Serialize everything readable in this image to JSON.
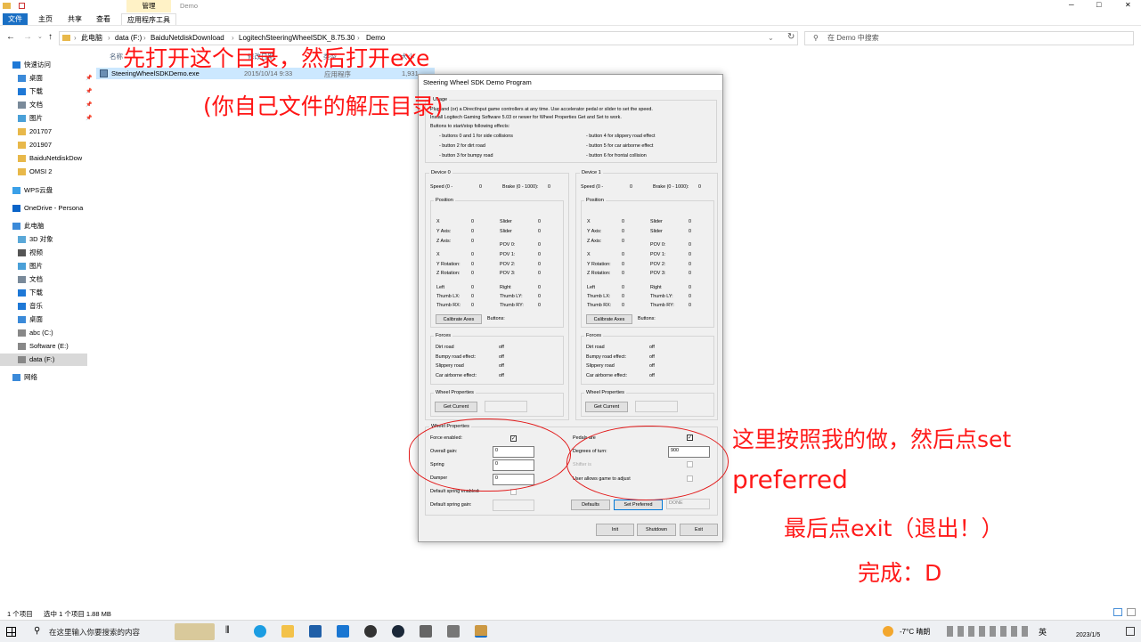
{
  "window": {
    "title": "Demo",
    "ribbon_context_tab": "管理",
    "controls": {
      "minimize": "─",
      "maximize": "□",
      "close": "✕"
    }
  },
  "ribbon": {
    "tabs": [
      "文件",
      "主页",
      "共享",
      "查看"
    ],
    "context_tool": "应用程序工具"
  },
  "address": {
    "crumbs": [
      "此电脑",
      "data (F:)",
      "BaiduNetdiskDownload",
      "LogitechSteeringWheelSDK_8.75.30",
      "Demo"
    ],
    "search_placeholder": "在 Demo 中搜索"
  },
  "nav": {
    "items": [
      {
        "label": "快速访问",
        "icon": "star-icon",
        "pinned": false
      },
      {
        "label": "桌面",
        "icon": "desktop-icon",
        "pinned": true
      },
      {
        "label": "下载",
        "icon": "download-icon",
        "pinned": true
      },
      {
        "label": "文档",
        "icon": "document-icon",
        "pinned": true
      },
      {
        "label": "图片",
        "icon": "pictures-icon",
        "pinned": true
      },
      {
        "label": "201707",
        "icon": "folder-icon",
        "pinned": false
      },
      {
        "label": "201907",
        "icon": "folder-icon",
        "pinned": false
      },
      {
        "label": "BaiduNetdiskDow",
        "icon": "folder-icon",
        "pinned": false
      },
      {
        "label": "OMSI 2",
        "icon": "folder-icon",
        "pinned": false
      },
      {
        "label": "WPS云盘",
        "icon": "cloud-icon",
        "pinned": false
      },
      {
        "label": "OneDrive - Persona",
        "icon": "onedrive-icon",
        "pinned": false
      },
      {
        "label": "此电脑",
        "icon": "computer-icon",
        "pinned": false
      },
      {
        "label": "3D 对象",
        "icon": "3d-objects-icon",
        "pinned": false
      },
      {
        "label": "视频",
        "icon": "video-icon",
        "pinned": false
      },
      {
        "label": "图片",
        "icon": "pictures-icon",
        "pinned": false
      },
      {
        "label": "文档",
        "icon": "document-icon",
        "pinned": false
      },
      {
        "label": "下载",
        "icon": "download-icon",
        "pinned": false
      },
      {
        "label": "音乐",
        "icon": "music-icon",
        "pinned": false
      },
      {
        "label": "桌面",
        "icon": "desktop-icon",
        "pinned": false
      },
      {
        "label": "abc (C:)",
        "icon": "drive-icon",
        "pinned": false
      },
      {
        "label": "Software (E:)",
        "icon": "drive-icon",
        "pinned": false
      },
      {
        "label": "data (F:)",
        "icon": "drive-icon",
        "pinned": false
      },
      {
        "label": "网络",
        "icon": "network-icon",
        "pinned": false
      }
    ]
  },
  "filelist": {
    "headers": [
      "名称",
      "修改日期",
      "类型",
      "大小"
    ],
    "rows": [
      {
        "name": "SteeringWheelSDKDemo.exe",
        "date": "2015/10/14 9:33",
        "type": "应用程序",
        "size": "1,931"
      }
    ]
  },
  "statusbar": {
    "count": "1 个项目",
    "selected": "选中 1 个项目  1.88 MB"
  },
  "dialog": {
    "title": "Steering Wheel SDK Demo Program",
    "usage_label": "Usage",
    "usage_line1": "Plug and (or) a DirectInput game controllers at any time. Use accelerator pedal or slider to set the speed.",
    "usage_line2": "Install Logitech Gaming Software 5.03 or newer for Wheel Properties Get and Set to work.",
    "usage_line3": "Buttons to start/stop following effects:",
    "effects_left": [
      "- buttons 0 and 1 for side collisions",
      "- button 2 for dirt road",
      "- button 3 for bumpy road"
    ],
    "effects_right": [
      "- button 4 for slippery road effect",
      "- button 5 for car airborne effect",
      "- button 6 for frontal collision"
    ],
    "devices": [
      {
        "label": "Device 0",
        "speed_label": "Speed (0 -",
        "speed_val": "0",
        "brake_label": "Brake (0 - 1000):",
        "brake_val": "0",
        "position_label": "Position",
        "axes_left": [
          [
            "X",
            "0"
          ],
          [
            "Y Axis:",
            "0"
          ],
          [
            "Z Axis:",
            "0"
          ]
        ],
        "axes_right": [
          [
            "Slider",
            "0"
          ],
          [
            "Slider",
            "0"
          ]
        ],
        "pov": [
          [
            "POV 0:",
            "0"
          ],
          [
            "POV 1:",
            "0"
          ],
          [
            "POV 2:",
            "0"
          ],
          [
            "POV 3:",
            "0"
          ]
        ],
        "rot": [
          [
            "X",
            "0"
          ],
          [
            "Y Rotation:",
            "0"
          ],
          [
            "Z Rotation:",
            "0"
          ]
        ],
        "thumb_left": [
          [
            "Left",
            "0"
          ],
          [
            "Thumb LX:",
            "0"
          ],
          [
            "Thumb RX:",
            "0"
          ]
        ],
        "thumb_right": [
          [
            "Right",
            "0"
          ],
          [
            "Thumb LY:",
            "0"
          ],
          [
            "Thumb RY:",
            "0"
          ]
        ],
        "calibrate": "Calibrate Axes",
        "buttons_label": "Buttons:",
        "forces_label": "Forces",
        "forces": [
          [
            "Dirt road",
            "off"
          ],
          [
            "Bumpy road effect:",
            "off"
          ],
          [
            "Slippery road",
            "off"
          ],
          [
            "Car airborne effect:",
            "off"
          ]
        ],
        "wheel_props": "Wheel Properties",
        "get_current": "Get Current"
      },
      {
        "label": "Device 1",
        "speed_label": "Speed (0 -",
        "speed_val": "0",
        "brake_label": "Brake (0 - 1000):",
        "brake_val": "0",
        "position_label": "Position",
        "axes_left": [
          [
            "X",
            "0"
          ],
          [
            "Y Axis:",
            "0"
          ],
          [
            "Z Axis:",
            "0"
          ]
        ],
        "axes_right": [
          [
            "Slider",
            "0"
          ],
          [
            "Slider",
            "0"
          ]
        ],
        "pov": [
          [
            "POV 0:",
            "0"
          ],
          [
            "POV 1:",
            "0"
          ],
          [
            "POV 2:",
            "0"
          ],
          [
            "POV 3:",
            "0"
          ]
        ],
        "rot": [
          [
            "X",
            "0"
          ],
          [
            "Y Rotation:",
            "0"
          ],
          [
            "Z Rotation:",
            "0"
          ]
        ],
        "thumb_left": [
          [
            "Left",
            "0"
          ],
          [
            "Thumb LX:",
            "0"
          ],
          [
            "Thumb RX:",
            "0"
          ]
        ],
        "thumb_right": [
          [
            "Right",
            "0"
          ],
          [
            "Thumb LY:",
            "0"
          ],
          [
            "Thumb RY:",
            "0"
          ]
        ],
        "calibrate": "Calibrate Axes",
        "buttons_label": "Buttons:",
        "forces_label": "Forces",
        "forces": [
          [
            "Dirt road",
            "off"
          ],
          [
            "Bumpy road effect:",
            "off"
          ],
          [
            "Slippery road",
            "off"
          ],
          [
            "Car airborne effect:",
            "off"
          ]
        ],
        "wheel_props": "Wheel Properties",
        "get_current": "Get Current"
      }
    ],
    "wheel": {
      "label": "Wheel Properties",
      "force_enabled": "Force enabled:",
      "overall_gain": "Overall gain:",
      "overall_gain_val": "0",
      "spring": "Spring",
      "spring_val": "0",
      "damper": "Damper",
      "damper_val": "0",
      "default_spring_enabled": "Default spring enabled:",
      "default_spring_gain": "Default spring gain:",
      "pedals": "Pedals are",
      "degrees": "Degrees of turn:",
      "degrees_val": "900",
      "shifter": "Shifter is",
      "user_allows": "User allows game to adjust",
      "defaults_btn": "Defaults",
      "set_preferred_btn": "Set Preferred",
      "done_label": "DONE"
    },
    "footer": {
      "init": "Init",
      "shutdown": "Shutdown",
      "exit": "Exit"
    }
  },
  "annotations": {
    "a1": "先打开这个目录，然后打开exe",
    "a2": "(你自己文件的解压目录)",
    "a3": "这里按照我的做，然后点set",
    "a4": "preferred",
    "a5": "最后点exit（退出！）",
    "a6": "完成：D"
  },
  "taskbar": {
    "search_placeholder": "在这里输入你要搜索的内容",
    "weather": "-7°C  晴朗",
    "ime": "英",
    "date": "2023/1/5"
  },
  "colors": {
    "annotation": "#ff1414",
    "file_tab": "#1a6fc4"
  }
}
